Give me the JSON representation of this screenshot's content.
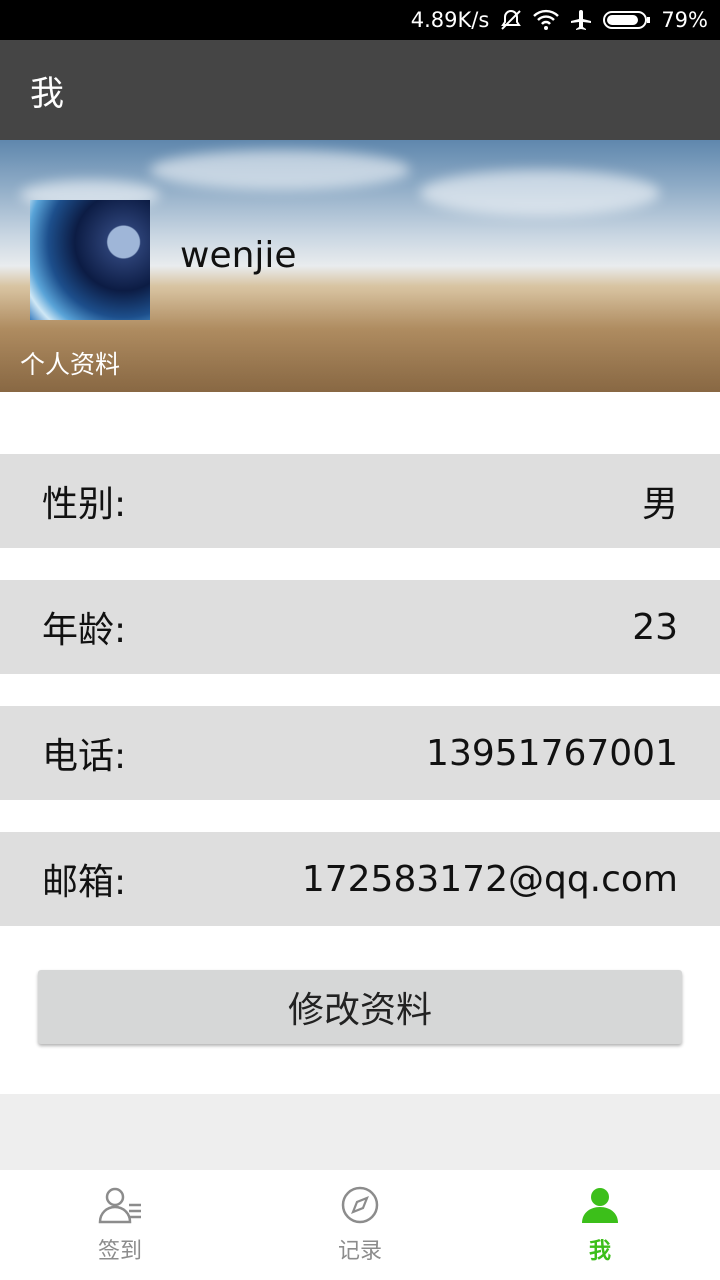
{
  "status_bar": {
    "speed": "4.89K/s",
    "battery": "79%",
    "icons": [
      "mute-icon",
      "wifi-icon",
      "airplane-icon",
      "battery-icon"
    ]
  },
  "app_bar": {
    "title": "我"
  },
  "profile": {
    "username": "wenjie",
    "section_label": "个人资料"
  },
  "info": {
    "rows": [
      {
        "label": "性别:",
        "value": "男"
      },
      {
        "label": "年龄:",
        "value": "23"
      },
      {
        "label": "电话:",
        "value": "13951767001"
      },
      {
        "label": "邮箱:",
        "value": "172583172@qq.com"
      }
    ]
  },
  "edit_button": {
    "label": "修改资料"
  },
  "tabs": [
    {
      "label": "签到",
      "icon": "user-list-icon",
      "active": false
    },
    {
      "label": "记录",
      "icon": "compass-icon",
      "active": false
    },
    {
      "label": "我",
      "icon": "person-icon",
      "active": true
    }
  ],
  "colors": {
    "active_tab": "#3cbf1a",
    "app_bar": "#454545"
  }
}
